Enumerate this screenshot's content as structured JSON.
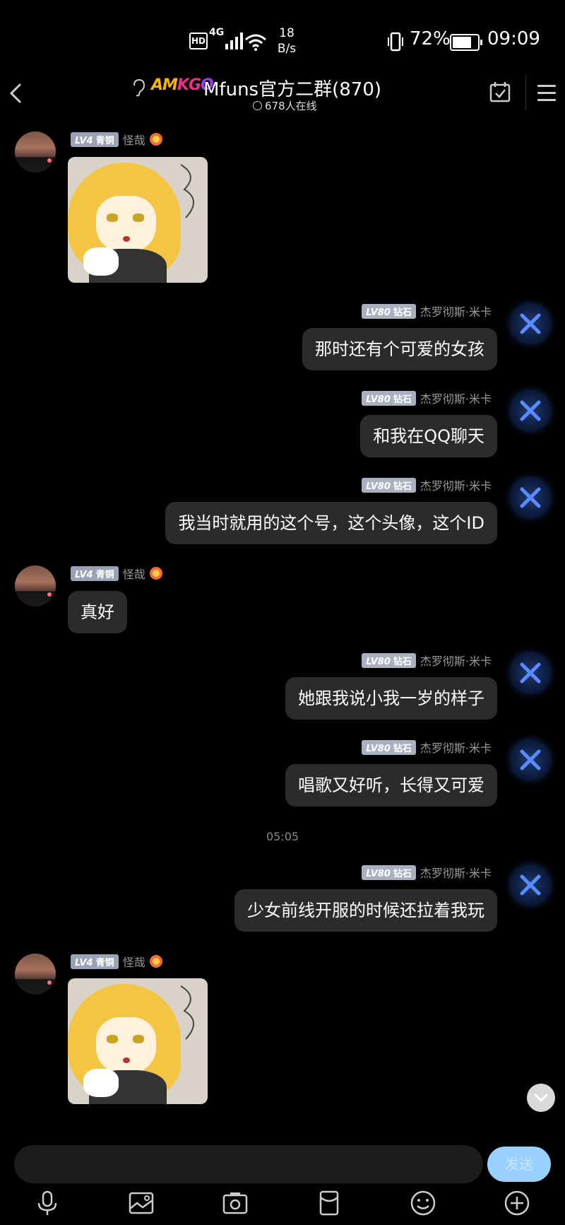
{
  "status_bar": {
    "hd": "HD",
    "network": "4G",
    "speed_value": "18",
    "speed_unit": "B/s",
    "battery_pct": "72%",
    "battery_level": 0.72,
    "time": "09:09"
  },
  "header": {
    "logo_text": [
      "AM",
      "KG",
      "O"
    ],
    "title": "Mfuns官方二群(870)",
    "online": "678人在线"
  },
  "messages": [
    {
      "side": "left",
      "level": "LV4",
      "rank": "青铜",
      "name": "怪哉",
      "type": "sticker"
    },
    {
      "side": "right",
      "level": "LV80",
      "rank": "钻石",
      "name": "杰罗彻斯·米卡",
      "text": "那时还有个可爱的女孩"
    },
    {
      "side": "right",
      "level": "LV80",
      "rank": "钻石",
      "name": "杰罗彻斯·米卡",
      "text": "和我在QQ聊天"
    },
    {
      "side": "right",
      "level": "LV80",
      "rank": "钻石",
      "name": "杰罗彻斯·米卡",
      "text": "我当时就用的这个号，这个头像，这个ID"
    },
    {
      "side": "left",
      "level": "LV4",
      "rank": "青铜",
      "name": "怪哉",
      "text": "真好"
    },
    {
      "side": "right",
      "level": "LV80",
      "rank": "钻石",
      "name": "杰罗彻斯·米卡",
      "text": "她跟我说小我一岁的样子"
    },
    {
      "side": "right",
      "level": "LV80",
      "rank": "钻石",
      "name": "杰罗彻斯·米卡",
      "text": "唱歌又好听，长得又可爱"
    },
    {
      "side": "right",
      "level": "LV80",
      "rank": "钻石",
      "name": "杰罗彻斯·米卡",
      "text": "少女前线开服的时候还拉着我玩"
    },
    {
      "side": "left",
      "level": "LV4",
      "rank": "青铜",
      "name": "怪哉",
      "type": "sticker"
    }
  ],
  "timestamp": "05:05",
  "input": {
    "send_label": "发送"
  },
  "toolbar_icons": [
    "mic-icon",
    "image-icon",
    "camera-icon",
    "red-packet-icon",
    "emoji-icon",
    "plus-icon"
  ]
}
